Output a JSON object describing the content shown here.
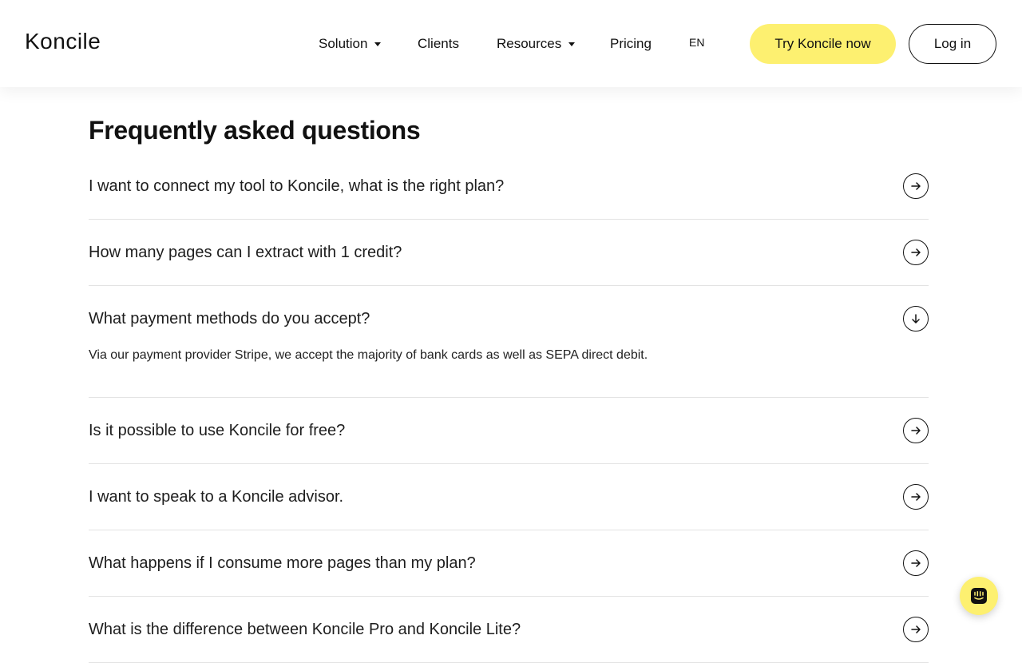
{
  "header": {
    "logo": "Koncile",
    "nav": [
      {
        "label": "Solution",
        "has_dropdown": true
      },
      {
        "label": "Clients",
        "has_dropdown": false
      },
      {
        "label": "Resources",
        "has_dropdown": true
      },
      {
        "label": "Pricing",
        "has_dropdown": false
      }
    ],
    "lang": "EN",
    "try_label": "Try Koncile now",
    "login_label": "Log in"
  },
  "faq": {
    "title": "Frequently asked questions",
    "items": [
      {
        "q": "I want to connect my tool to Koncile, what is the right plan?",
        "icon": "arrow-right-icon"
      },
      {
        "q": "How many pages can I extract with 1 credit?",
        "icon": "arrow-right-icon"
      },
      {
        "q": "What payment methods do you accept?",
        "icon": "arrow-down-icon",
        "a": "Via our payment provider Stripe, we accept the majority of bank cards as well as SEPA direct debit."
      },
      {
        "q": "Is it possible to use Koncile for free?",
        "icon": "arrow-right-icon"
      },
      {
        "q": "I want to speak to a Koncile advisor.",
        "icon": "arrow-right-icon"
      },
      {
        "q": "What happens if I consume more pages than my plan?",
        "icon": "arrow-right-icon"
      },
      {
        "q": "What is the difference between Koncile Pro and Koncile Lite?",
        "icon": "arrow-right-icon"
      }
    ]
  },
  "colors": {
    "accent": "#fdf070",
    "text": "#111111",
    "divider": "#e3e3e3"
  },
  "chat": {
    "icon": "chat-icon"
  }
}
